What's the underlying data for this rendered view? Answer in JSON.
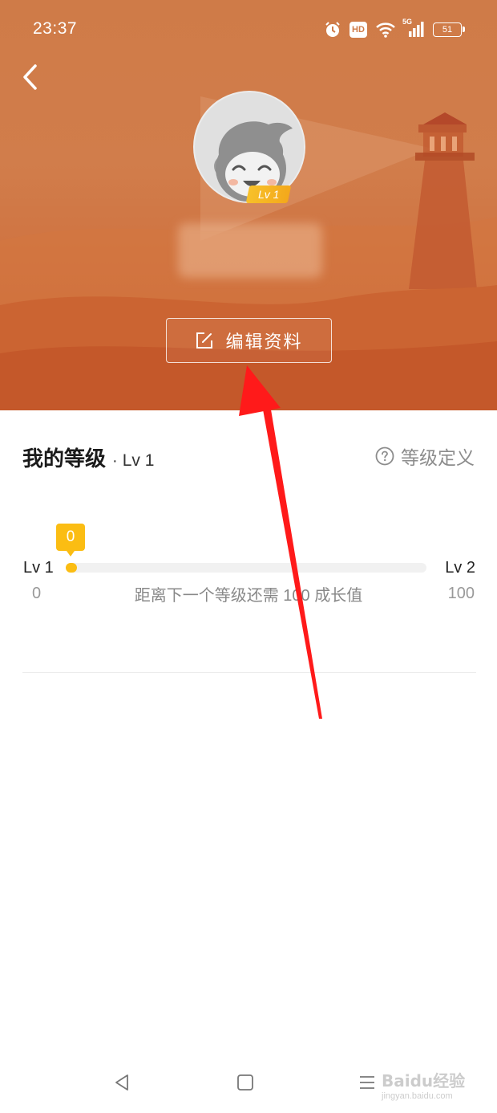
{
  "status_bar": {
    "time": "23:37",
    "hd_label": "HD",
    "network_label": "5G",
    "battery": "51"
  },
  "profile": {
    "level_badge": "Lv 1",
    "edit_button_label": "编辑资料"
  },
  "level": {
    "title": "我的等级",
    "separator": "·",
    "current_level": "Lv 1",
    "definition_link": "等级定义",
    "bubble_value": "0",
    "start_level": "Lv 1",
    "end_level": "Lv 2",
    "start_value": "0",
    "end_value": "100",
    "progress_fraction": 0.02,
    "hint": "距离下一个等级还需 100 成长值"
  },
  "watermark": {
    "brand": "Baidu经验",
    "url": "jingyan.baidu.com"
  },
  "colors": {
    "header": "#cf7b48",
    "accent": "#fbbd13",
    "arrow": "#ff0000"
  }
}
